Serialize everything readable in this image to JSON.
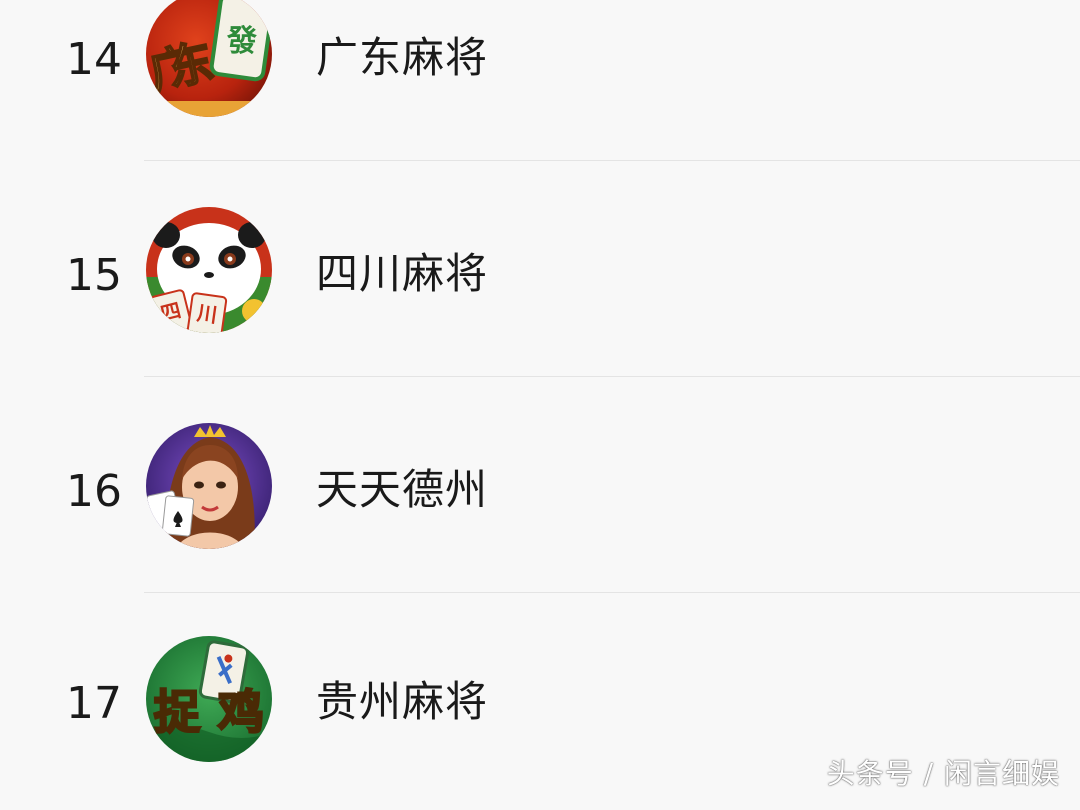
{
  "items": [
    {
      "rank": "14",
      "name": "广东麻将",
      "icon": "guangdong-mahjong-icon",
      "icon_text": "广东",
      "tile_text": "發"
    },
    {
      "rank": "15",
      "name": "四川麻将",
      "icon": "sichuan-mahjong-panda-icon",
      "tile_text_1": "四",
      "tile_text_2": "川"
    },
    {
      "rank": "16",
      "name": "天天德州",
      "icon": "texas-holdem-girl-icon"
    },
    {
      "rank": "17",
      "name": "贵州麻将",
      "icon": "guizhou-mahjong-icon",
      "icon_text": "捉鸡"
    }
  ],
  "watermark": "头条号 / 闲言细娱",
  "colors": {
    "background": "#f8f8f8",
    "text": "#1a1a1a",
    "divider": "#e4e4e4"
  }
}
